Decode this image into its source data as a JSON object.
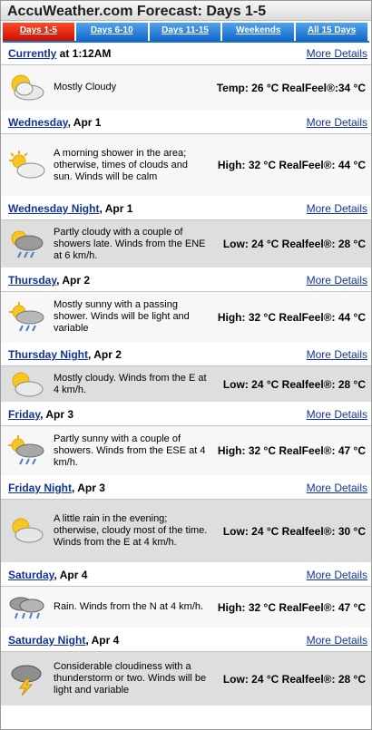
{
  "title": "AccuWeather.com Forecast: Days 1-5",
  "tabs": [
    "Days 1-5",
    "Days 6-10",
    "Days 11-15",
    "Weekends",
    "All 15 Days"
  ],
  "more_label": "More Details",
  "periods": [
    {
      "name": "Currently",
      "date": " at 1:12AM",
      "icon": "mostly-cloudy-icon",
      "desc": "Mostly Cloudy",
      "temps": "Temp: 26 °C  RealFeel®:34 °C"
    },
    {
      "name": "Wednesday",
      "date": ", Apr 1",
      "icon": "partly-sunny-icon",
      "desc": "A morning shower in the area; otherwise, times of clouds and sun. Winds will be calm",
      "temps": "High: 32 °C  RealFeel®: 44 °C"
    },
    {
      "name": "Wednesday Night",
      "date": ", Apr 1",
      "icon": "cloud-showers-icon",
      "desc": "Partly cloudy with a couple of showers late. Winds from the ENE at 6 km/h.",
      "temps": "Low: 24 °C  Realfeel®: 28 °C"
    },
    {
      "name": "Thursday",
      "date": ", Apr 2",
      "icon": "sun-shower-icon",
      "desc": "Mostly sunny with a passing shower. Winds will be light and variable",
      "temps": "High: 32 °C  RealFeel®: 44 °C"
    },
    {
      "name": "Thursday Night",
      "date": ", Apr 2",
      "icon": "mostly-cloudy-night-icon",
      "desc": "Mostly cloudy. Winds from the E at 4 km/h.",
      "temps": "Low: 24 °C  Realfeel®: 28 °C"
    },
    {
      "name": "Friday",
      "date": ", Apr 3",
      "icon": "sun-rain-icon",
      "desc": "Partly sunny with a couple of showers. Winds from the ESE at 4 km/h.",
      "temps": "High: 32 °C  RealFeel®: 47 °C"
    },
    {
      "name": "Friday Night",
      "date": ", Apr 3",
      "icon": "night-cloud-icon",
      "desc": "A little rain in the evening; otherwise, cloudy most of the time. Winds from the E at 4 km/h.",
      "temps": "Low: 24 °C  Realfeel®: 30 °C"
    },
    {
      "name": "Saturday",
      "date": ", Apr 4",
      "icon": "rain-icon",
      "desc": "Rain. Winds from the N at 4 km/h.",
      "temps": "High: 32 °C  RealFeel®: 47 °C"
    },
    {
      "name": "Saturday Night",
      "date": ", Apr 4",
      "icon": "thunderstorm-icon",
      "desc": "Considerable cloudiness with a thunderstorm or two. Winds will be light and variable",
      "temps": "Low: 24 °C  Realfeel®: 28 °C"
    }
  ]
}
